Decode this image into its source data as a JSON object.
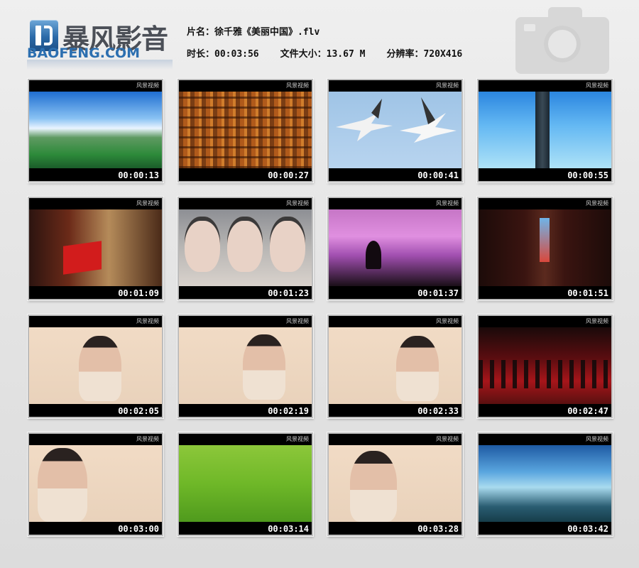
{
  "app": {
    "brand": "暴风影音",
    "brand_sub": "BAOFENG.COM"
  },
  "info": {
    "name_label": "片名：",
    "name_value": "徐千雅《美丽中国》.flv",
    "duration_label": "时长：",
    "duration_value": "00:03:56",
    "size_label": "文件大小：",
    "size_value": "13.67 M",
    "resolution_label": "分辨率：",
    "resolution_value": "720X416"
  },
  "thumbs": [
    {
      "time": "00:00:13",
      "scene": "grassland-lake"
    },
    {
      "time": "00:00:27",
      "scene": "forbidden-city"
    },
    {
      "time": "00:00:41",
      "scene": "cranes-flying"
    },
    {
      "time": "00:00:55",
      "scene": "monument-sky"
    },
    {
      "time": "00:01:09",
      "scene": "red-flag"
    },
    {
      "time": "00:01:23",
      "scene": "singer-triple-face"
    },
    {
      "time": "00:01:37",
      "scene": "purple-sky-rock"
    },
    {
      "time": "00:01:51",
      "scene": "gate-corridor"
    },
    {
      "time": "00:02:05",
      "scene": "singer-closeup"
    },
    {
      "time": "00:02:19",
      "scene": "singer-side"
    },
    {
      "time": "00:02:33",
      "scene": "singer-smile"
    },
    {
      "time": "00:02:47",
      "scene": "soldiers-flag"
    },
    {
      "time": "00:03:00",
      "scene": "singer-singing"
    },
    {
      "time": "00:03:14",
      "scene": "green-field"
    },
    {
      "time": "00:03:28",
      "scene": "singer-hand"
    },
    {
      "time": "00:03:42",
      "scene": "mountains-clouds"
    }
  ],
  "colors": {
    "brand_blue": "#2c6fb0",
    "timestamp": "#ffffff",
    "frame_bg": "#000000"
  }
}
